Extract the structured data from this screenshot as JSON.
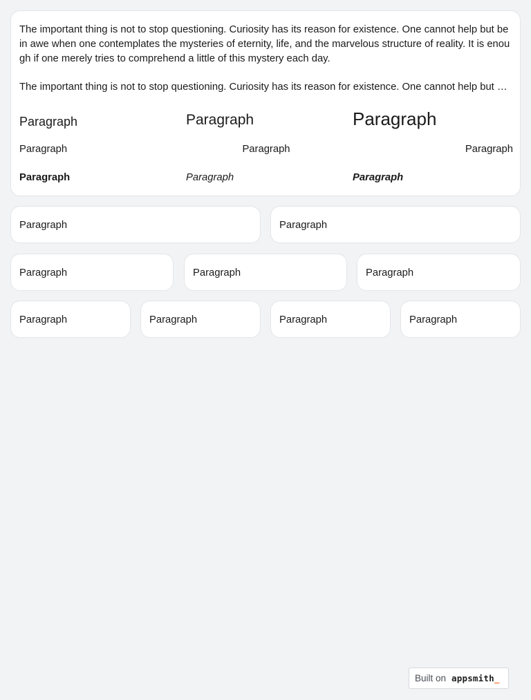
{
  "main_card": {
    "long_paragraph": "The important thing is not to stop questioning. Curiosity has its reason for existence. One cannot help but be in awe when one contemplates the mysteries of eternity, life, and the marvelous structure of reality. It is enough if one merely tries to comprehend a little of this mystery each day.",
    "truncated_paragraph": "The important thing is not to stop questioning. Curiosity has its reason for existence. One cannot help but be in awe when one contemplates the mysteries of eternity, life, and the marvelous structure of reality.",
    "size_row": [
      "Paragraph",
      "Paragraph",
      "Paragraph"
    ],
    "align_row": [
      "Paragraph",
      "Paragraph",
      "Paragraph"
    ],
    "style_row": [
      "Paragraph",
      "Paragraph",
      "Paragraph"
    ]
  },
  "two_column_row": [
    "Paragraph",
    "Paragraph"
  ],
  "three_column_row": [
    "Paragraph",
    "Paragraph",
    "Paragraph"
  ],
  "four_column_row": [
    "Paragraph",
    "Paragraph",
    "Paragraph",
    "Paragraph"
  ],
  "footer": {
    "built_on_label": "Built on",
    "brand_name": "appsmith",
    "brand_cursor": "_",
    "brand_cursor_color": "#f86a2b"
  }
}
